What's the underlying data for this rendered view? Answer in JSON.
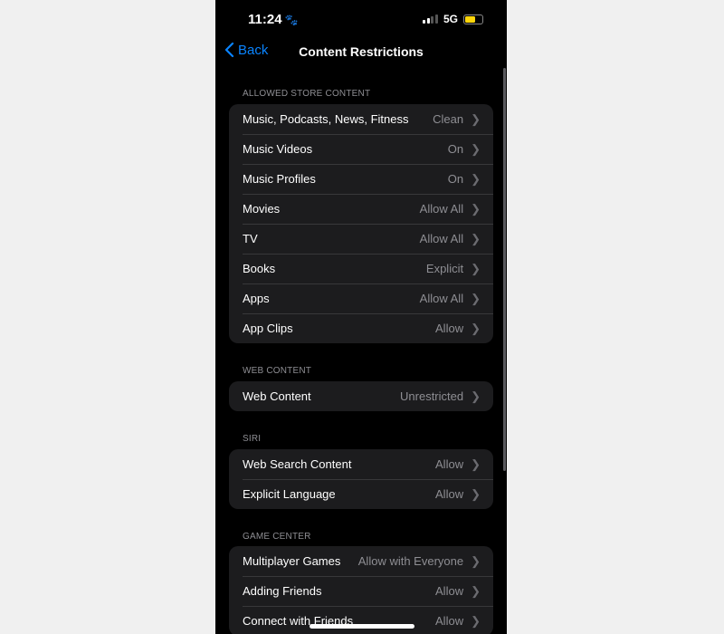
{
  "status": {
    "time": "11:24",
    "network": "5G",
    "battery_color": "#ffd60a"
  },
  "nav": {
    "back": "Back",
    "title": "Content Restrictions"
  },
  "sections": [
    {
      "header": "ALLOWED STORE CONTENT",
      "rows": [
        {
          "label": "Music, Podcasts, News, Fitness",
          "value": "Clean"
        },
        {
          "label": "Music Videos",
          "value": "On"
        },
        {
          "label": "Music Profiles",
          "value": "On"
        },
        {
          "label": "Movies",
          "value": "Allow All"
        },
        {
          "label": "TV",
          "value": "Allow All"
        },
        {
          "label": "Books",
          "value": "Explicit"
        },
        {
          "label": "Apps",
          "value": "Allow All"
        },
        {
          "label": "App Clips",
          "value": "Allow"
        }
      ]
    },
    {
      "header": "WEB CONTENT",
      "rows": [
        {
          "label": "Web Content",
          "value": "Unrestricted"
        }
      ]
    },
    {
      "header": "SIRI",
      "rows": [
        {
          "label": "Web Search Content",
          "value": "Allow"
        },
        {
          "label": "Explicit Language",
          "value": "Allow"
        }
      ]
    },
    {
      "header": "GAME CENTER",
      "rows": [
        {
          "label": "Multiplayer Games",
          "value": "Allow with Everyone"
        },
        {
          "label": "Adding Friends",
          "value": "Allow"
        },
        {
          "label": "Connect with Friends",
          "value": "Allow"
        }
      ]
    }
  ]
}
